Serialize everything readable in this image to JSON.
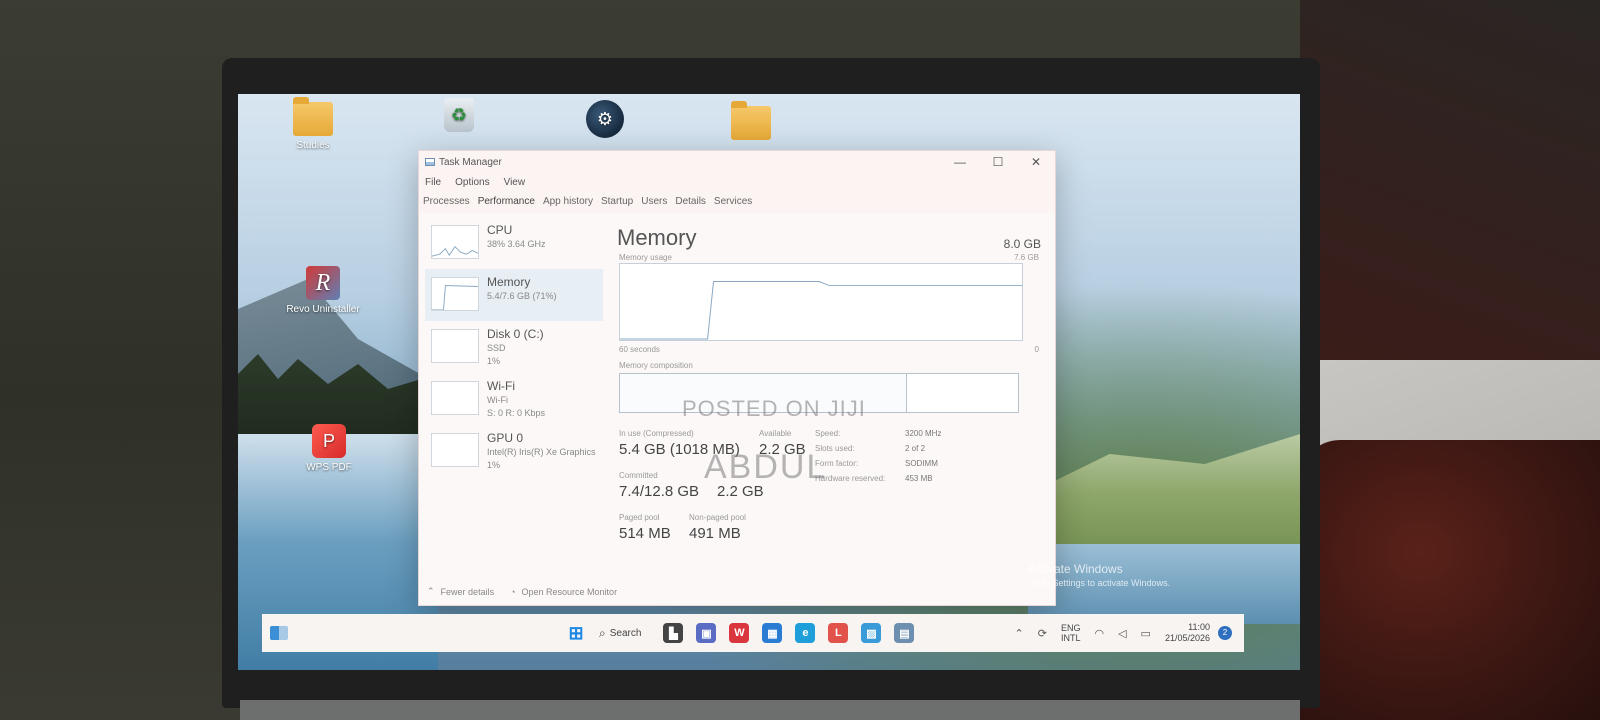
{
  "desktop": {
    "icons": [
      {
        "label": "Studies",
        "icon": "folder-icon"
      },
      {
        "label": "",
        "icon": "recycle-bin-icon"
      },
      {
        "label": "",
        "icon": "steam-icon"
      },
      {
        "label": "",
        "icon": "folder-icon"
      },
      {
        "label": "Revo Uninstaller",
        "icon": "revo-uninstaller-icon"
      },
      {
        "label": "WPS PDF",
        "icon": "wps-pdf-icon"
      }
    ],
    "activation": {
      "line1": "Activate Windows",
      "line2": "Go to Settings to activate Windows."
    }
  },
  "task_manager": {
    "title": "Task Manager",
    "menu": [
      "File",
      "Options",
      "View"
    ],
    "tabs": [
      "Processes",
      "Performance",
      "App history",
      "Startup",
      "Users",
      "Details",
      "Services"
    ],
    "active_tab": "Performance",
    "sidebar": [
      {
        "name": "CPU",
        "sub1": "38%  3.64 GHz",
        "sub2": ""
      },
      {
        "name": "Memory",
        "sub1": "5.4/7.6 GB (71%)",
        "sub2": ""
      },
      {
        "name": "Disk 0 (C:)",
        "sub1": "SSD",
        "sub2": "1%"
      },
      {
        "name": "Wi-Fi",
        "sub1": "Wi-Fi",
        "sub2": "S: 0  R: 0 Kbps"
      },
      {
        "name": "GPU 0",
        "sub1": "Intel(R) Iris(R) Xe Graphics",
        "sub2": "1%"
      }
    ],
    "active_item": "Memory",
    "memory": {
      "heading": "Memory",
      "total": "8.0 GB",
      "usage_label": "Memory usage",
      "usage_max": "7.6 GB",
      "time_left": "60 seconds",
      "time_right": "0",
      "composition_label": "Memory composition",
      "in_use_fraction": 0.72,
      "stats": {
        "in_use_label": "In use (Compressed)",
        "in_use_value": "5.4 GB (1018 MB)",
        "available_label": "Available",
        "available_value": "2.2 GB",
        "committed_label": "Committed",
        "committed_value": "7.4/12.8 GB",
        "cached_value": "2.2 GB",
        "paged_pool_label": "Paged pool",
        "paged_pool_value": "514 MB",
        "nonpaged_pool_label": "Non-paged pool",
        "nonpaged_pool_value": "491 MB"
      },
      "details": {
        "speed_label": "Speed:",
        "speed_value": "3200 MHz",
        "slots_label": "Slots used:",
        "slots_value": "2 of 2",
        "form_label": "Form factor:",
        "form_value": "SODIMM",
        "reserved_label": "Hardware reserved:",
        "reserved_value": "453 MB"
      }
    },
    "footer": {
      "fewer_details": "Fewer details",
      "open_monitor": "Open Resource Monitor"
    }
  },
  "watermark": {
    "line1": "POSTED ON JIJI",
    "line2": "ABDUL"
  },
  "taskbar": {
    "search_label": "Search",
    "apps": [
      {
        "icon": "file-explorer-icon",
        "glyph": "▙",
        "color": "#444444"
      },
      {
        "icon": "teams-icon",
        "glyph": "▣",
        "color": "#5b6cc4"
      },
      {
        "icon": "wps-office-icon",
        "glyph": "W",
        "color": "#d9363e"
      },
      {
        "icon": "store-icon",
        "glyph": "▦",
        "color": "#2b7cd3"
      },
      {
        "icon": "edge-icon",
        "glyph": "e",
        "color": "#1e9fd9"
      },
      {
        "icon": "libreoffice-icon",
        "glyph": "L",
        "color": "#e0524a"
      },
      {
        "icon": "photos-icon",
        "glyph": "▨",
        "color": "#3a9bd9"
      },
      {
        "icon": "task-manager-icon",
        "glyph": "▤",
        "color": "#6d8fb0"
      }
    ],
    "tray": {
      "lang_line1": "ENG",
      "lang_line2": "INTL",
      "time": "11:00",
      "date": "21/05/2026",
      "notifications": "2"
    }
  }
}
